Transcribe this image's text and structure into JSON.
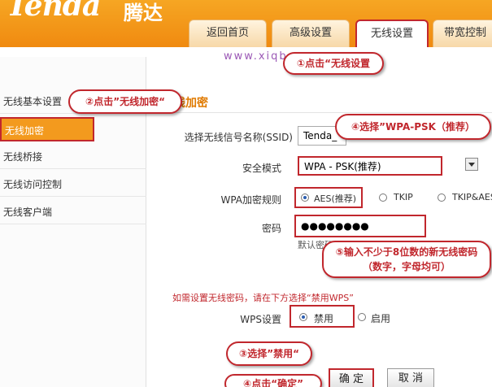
{
  "header": {
    "logo": "Tenda",
    "logo_cn": "腾达",
    "tabs": [
      {
        "label": "返回首页"
      },
      {
        "label": "高级设置"
      },
      {
        "label": "无线设置"
      },
      {
        "label": "带宽控制"
      }
    ]
  },
  "watermark": "www.xiqb.com",
  "sidebar": {
    "items": [
      {
        "label": "无线基本设置"
      },
      {
        "label": "无线加密"
      },
      {
        "label": "无线桥接"
      },
      {
        "label": "无线访问控制"
      },
      {
        "label": "无线客户端"
      }
    ]
  },
  "main": {
    "section_title": "线加密",
    "ssid_label": "选择无线信号名称(SSID)",
    "ssid_value": "Tenda_",
    "security_label": "安全模式",
    "security_value": "WPA - PSK(推荐)",
    "wpa_rule_label": "WPA加密规则",
    "wpa_rules": [
      {
        "label": "AES(推荐)",
        "selected": true
      },
      {
        "label": "TKIP",
        "selected": false
      },
      {
        "label": "TKIP&AES",
        "selected": false
      }
    ],
    "password_label": "密码",
    "password_value": "●●●●●●●●",
    "default_hint": "默认密码",
    "warn_text": "如需设置无线密码，请在下方选择“禁用WPS”",
    "wps_label": "WPS设置",
    "wps_options": [
      {
        "label": "禁用",
        "selected": true
      },
      {
        "label": "启用",
        "selected": false
      }
    ],
    "ok_button": "确 定",
    "cancel_button": "取 消"
  },
  "callouts": {
    "c1": "①点击“无线设置",
    "c2": "②点击”无线加密“",
    "c3": "③选择”禁用“",
    "c4": "④选择”WPA-PSK（推荐）",
    "c5_line1": "⑤输入不少于8位数的新无线密码",
    "c5_line2": "（数字，字母均可）",
    "c6": "④点击“确定”"
  },
  "colors": {
    "header_orange": "#f08a10",
    "callout_red": "#c1272d",
    "active_sidebar": "#f39a1e",
    "section_title": "#e07a00"
  }
}
